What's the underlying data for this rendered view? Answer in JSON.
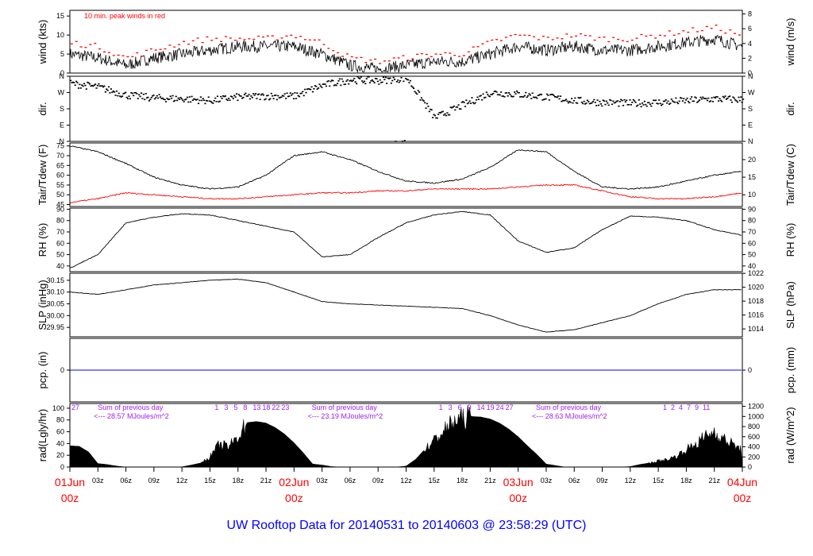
{
  "chart_data": {
    "type": "line",
    "title": "UW Rooftop Data for 20140531  to  20140603 @ 23:58:29  (UTC)",
    "x": {
      "unit": "hours since 01Jun 00z",
      "range": [
        0,
        72
      ],
      "hour_labels": [
        "03z",
        "06z",
        "09z",
        "12z",
        "15z",
        "18z",
        "21z"
      ],
      "day_labels": [
        {
          "hour": 0,
          "day": "01Jun",
          "time": "00z"
        },
        {
          "hour": 24,
          "day": "02Jun",
          "time": "00z"
        },
        {
          "hour": 48,
          "day": "03Jun",
          "time": "00z"
        },
        {
          "hour": 72,
          "day": "04Jun",
          "time": "00z"
        }
      ]
    },
    "sample_hours_step": 3,
    "panels": [
      {
        "id": "wind",
        "ylabel": "wind (kts)",
        "ylabel_right": "wind (m/s)",
        "ylim": [
          0,
          16.5
        ],
        "left_ticks": [
          0,
          5,
          10,
          15
        ],
        "right_axis": {
          "scale": 1.9438,
          "offset": 0,
          "ticks": [
            0,
            2,
            4,
            6,
            8
          ]
        },
        "annotation": "10 min. peak winds in red",
        "series": [
          {
            "name": "wind speed",
            "color": "#000000",
            "values": [
              5,
              4,
              2,
              4,
              5,
              6,
              7,
              7,
              7,
              5,
              2,
              1,
              2,
              3,
              3,
              5,
              7,
              6,
              7,
              6,
              6,
              7,
              8,
              9,
              7
            ]
          },
          {
            "name": "10 min peak",
            "color": "#ff0000",
            "values": [
              8,
              7,
              4,
              6,
              8,
              9,
              9,
              9,
              10,
              8,
              4,
              3,
              4,
              5,
              5,
              8,
              10,
              9,
              10,
              9,
              9,
              10,
              11,
              12,
              10
            ]
          }
        ]
      },
      {
        "id": "dir",
        "ylabel": "dir.",
        "ylabel_right": "dir.",
        "ylim": [
          0,
          360
        ],
        "category_ticks": [
          {
            "v": 0,
            "label": "N"
          },
          {
            "v": 90,
            "label": "E"
          },
          {
            "v": 180,
            "label": "S"
          },
          {
            "v": 270,
            "label": "W"
          },
          {
            "v": 360,
            "label": "N"
          }
        ],
        "series": [
          {
            "name": "wind direction (deg)",
            "color": "#000000",
            "values": [
              320,
              300,
              255,
              240,
              235,
              225,
              245,
              250,
              250,
              310,
              340,
              335,
              350,
              130,
              200,
              270,
              260,
              245,
              225,
              215,
              210,
              215,
              225,
              235,
              230
            ]
          }
        ]
      },
      {
        "id": "temp",
        "ylabel": "Tair/Tdew (F)",
        "ylabel_right": "Tair/Tdew (C)",
        "ylim": [
          44,
          76.5
        ],
        "left_ticks": [
          45,
          50,
          55,
          60,
          65,
          70,
          75
        ],
        "right_axis": {
          "scale": 1.8,
          "offset": 32,
          "ticks": [
            10,
            15,
            20
          ]
        },
        "series": [
          {
            "name": "Tair",
            "color": "#000000",
            "values": [
              75,
              72,
              66,
              59,
              55,
              53,
              54,
              60,
              70,
              72,
              68,
              62,
              57,
              56,
              58,
              64,
              73,
              72,
              62,
              54,
              53,
              54,
              57,
              60,
              62
            ]
          },
          {
            "name": "Tdew",
            "color": "#ff0000",
            "values": [
              46,
              48,
              51,
              50,
              49,
              48,
              48,
              49,
              50,
              51,
              51,
              52,
              52,
              53,
              53,
              53,
              54,
              55,
              55,
              52,
              49,
              48,
              48,
              49,
              51
            ]
          }
        ]
      },
      {
        "id": "rh",
        "ylabel": "RH (%)",
        "ylabel_right": "RH (%)",
        "ylim": [
          35,
          91
        ],
        "left_ticks": [
          40,
          50,
          60,
          70,
          80,
          90
        ],
        "right_axis": {
          "scale": 1,
          "offset": 0,
          "ticks": [
            40,
            50,
            60,
            70,
            80,
            90
          ]
        },
        "series": [
          {
            "name": "RH",
            "color": "#000000",
            "values": [
              38,
              50,
              78,
              83,
              86,
              85,
              80,
              75,
              70,
              48,
              50,
              65,
              78,
              85,
              88,
              85,
              62,
              52,
              56,
              72,
              84,
              83,
              80,
              72,
              67
            ]
          }
        ]
      },
      {
        "id": "slp",
        "ylabel": "SLP (inHg)",
        "ylabel_right": "SLP (hPa)",
        "ylim": [
          29.91,
          30.18
        ],
        "left_ticks": [
          29.95,
          30.0,
          30.05,
          30.1,
          30.15
        ],
        "left_tick_decimals": 2,
        "right_axis": {
          "scale": 0.02953,
          "offset": 0,
          "ticks": [
            1014,
            1016,
            1018,
            1020,
            1022
          ]
        },
        "series": [
          {
            "name": "SLP",
            "color": "#000000",
            "values": [
              30.1,
              30.09,
              30.11,
              30.13,
              30.14,
              30.15,
              30.155,
              30.14,
              30.1,
              30.06,
              30.05,
              30.045,
              30.04,
              30.035,
              30.03,
              30.0,
              29.96,
              29.93,
              29.94,
              29.97,
              30.0,
              30.05,
              30.09,
              30.11,
              30.11
            ]
          }
        ]
      },
      {
        "id": "pcp",
        "ylabel": "pcp. (in)",
        "ylabel_right": "pcp. (mm)",
        "ylim": [
          -1,
          1
        ],
        "left_ticks": [
          0
        ],
        "right_axis": {
          "scale": 0.03937,
          "offset": 0,
          "ticks": [
            0
          ]
        },
        "series": [
          {
            "name": "precip",
            "color": "#0000ff",
            "values": [
              0,
              0,
              0,
              0,
              0,
              0,
              0,
              0,
              0,
              0,
              0,
              0,
              0,
              0,
              0,
              0,
              0,
              0,
              0,
              0,
              0,
              0,
              0,
              0,
              0
            ]
          }
        ]
      },
      {
        "id": "rad",
        "ylabel": "rad(Lgly/hr)",
        "ylabel_right": "rad (W/m^2)",
        "ylim": [
          0,
          108
        ],
        "left_ticks": [
          0,
          20,
          40,
          60,
          80,
          100
        ],
        "right_axis": {
          "scale": 0.08598,
          "offset": 0,
          "ticks": [
            0,
            200,
            400,
            600,
            800,
            1000,
            1200
          ]
        },
        "hourly_wm2": [
          420,
          410,
          300,
          70,
          50,
          20,
          0,
          0,
          0,
          0,
          0,
          0,
          5,
          40,
          80,
          200,
          450,
          400,
          600,
          880,
          900,
          870,
          780,
          650,
          480,
          280,
          60,
          40,
          10,
          0,
          0,
          0,
          0,
          0,
          0,
          0,
          20,
          150,
          350,
          520,
          700,
          880,
          960,
          1000,
          990,
          950,
          870,
          750,
          600,
          420,
          250,
          60,
          30,
          0,
          0,
          0,
          0,
          0,
          0,
          0,
          10,
          50,
          80,
          120,
          150,
          220,
          350,
          450,
          600,
          700,
          550,
          450,
          320
        ],
        "daily_sums": [
          {
            "hour_marks": [
              "27"
            ],
            "label": "Sum of previous day",
            "value": "<--- 28.57 MJoules/m^2"
          },
          {
            "hour_marks": [
              "1",
              "3",
              "5",
              "8",
              "13",
              "18",
              "22",
              "23"
            ],
            "label": "Sum of previous day",
            "value": "<--- 23.19 MJoules/m^2"
          },
          {
            "hour_marks": [
              "1",
              "3",
              "6",
              "9",
              "14",
              "19",
              "24",
              "27"
            ],
            "label": "Sum of previous day",
            "value": "<--- 28.63 MJoules/m^2"
          },
          {
            "hour_marks": [
              "1",
              "2",
              "4",
              "7",
              "9",
              "11"
            ]
          }
        ]
      }
    ]
  }
}
